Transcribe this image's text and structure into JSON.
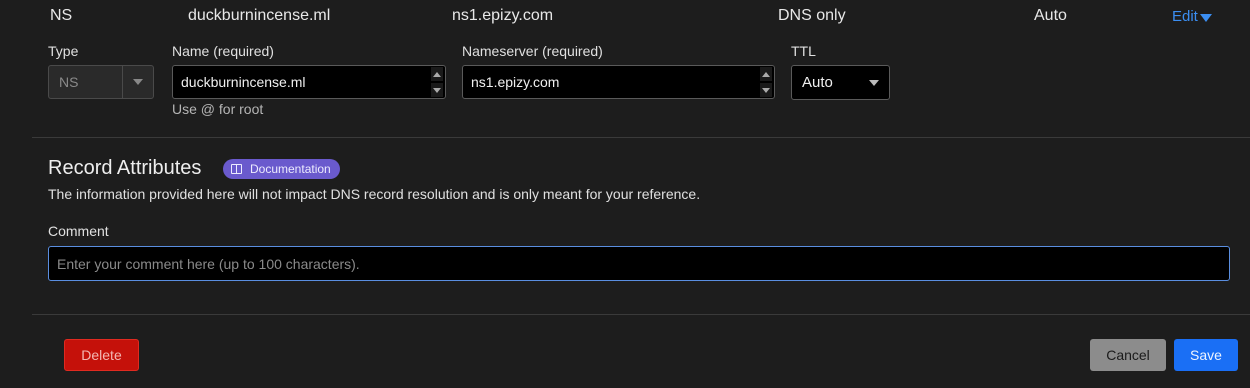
{
  "record_row": {
    "type": "NS",
    "name": "duckburnincense.ml",
    "content": "ns1.epizy.com",
    "proxy_status": "DNS only",
    "ttl": "Auto",
    "edit_label": "Edit"
  },
  "form": {
    "type_label": "Type",
    "type_value": "NS",
    "name_label": "Name (required)",
    "name_value": "duckburnincense.ml",
    "name_hint": "Use @ for root",
    "nameserver_label": "Nameserver (required)",
    "nameserver_value": "ns1.epizy.com",
    "ttl_label": "TTL",
    "ttl_value": "Auto"
  },
  "attributes": {
    "title": "Record Attributes",
    "doc_badge": "Documentation",
    "info": "The information provided here will not impact DNS record resolution and is only meant for your reference.",
    "comment_label": "Comment",
    "comment_placeholder": "Enter your comment here (up to 100 characters)."
  },
  "actions": {
    "delete": "Delete",
    "cancel": "Cancel",
    "save": "Save"
  },
  "colors": {
    "background": "#1d1d1d",
    "link": "#3b8ef2",
    "badge": "#6a5acd",
    "delete": "#c5110a",
    "save": "#1a6ff5"
  }
}
